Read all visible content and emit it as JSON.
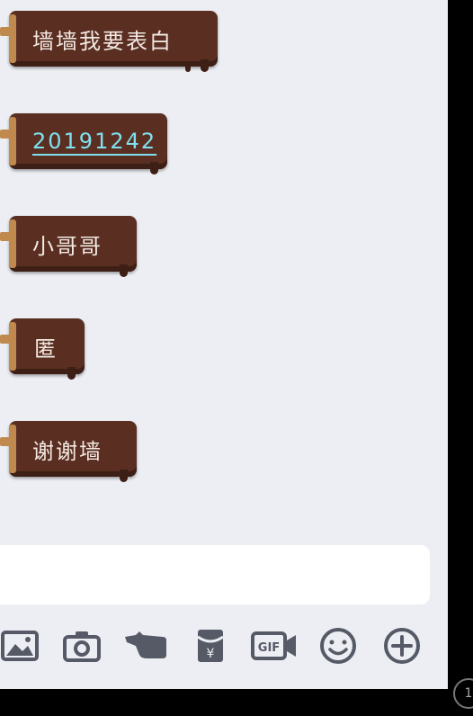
{
  "messages": [
    {
      "text": "墙墙我要表白"
    },
    {
      "text": "20191242"
    },
    {
      "text": "小哥哥"
    },
    {
      "text": "匿"
    },
    {
      "text": "谢谢墙"
    }
  ],
  "input": {
    "placeholder": ""
  },
  "toolbar": {
    "icons": [
      "image-icon",
      "camera-icon",
      "poke-hand-icon",
      "red-packet-icon",
      "gif-icon",
      "emoji-icon",
      "plus-icon"
    ],
    "gif_label": "GIF",
    "red_packet_label": "¥"
  },
  "corner_badge": "1",
  "colors": {
    "bubble": "#5a2f22",
    "bubble_edge": "#c08a4e",
    "link": "#7fe0f0",
    "background": "#eceef3",
    "icon": "#555a66"
  }
}
